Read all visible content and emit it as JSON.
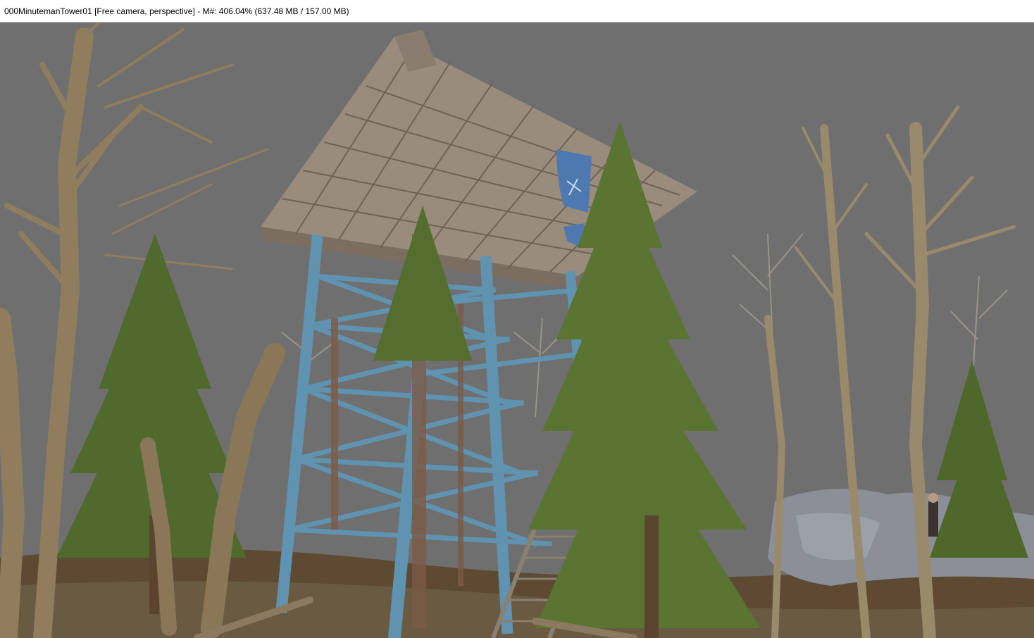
{
  "window": {
    "title": "000MinutemanTower01 [Free camera, perspective] - M#: 406.04% (637.48 MB / 157.00 MB)"
  },
  "viewport": {
    "background_color": "#6f6f6f",
    "scene_colors": {
      "tower_steel": "#5f93b0",
      "rust": "#7a5a45",
      "wood_planks": "#9a8c7c",
      "pine": "#4f6a2c",
      "bare_trees": "#8f7d5e",
      "ground": "#5e4a33",
      "rock": "#8b9098",
      "flag": "#4e79b0"
    }
  }
}
